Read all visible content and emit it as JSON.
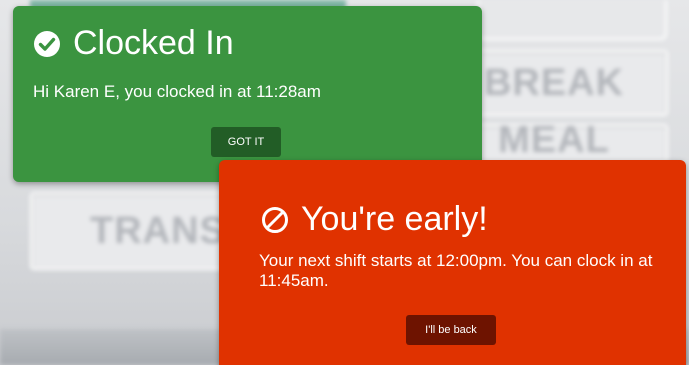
{
  "background": {
    "buttons": [
      {
        "label": "BREAK"
      },
      {
        "label": "MEAL"
      },
      {
        "label": "TRANSFER"
      }
    ]
  },
  "toasts": {
    "clocked_in": {
      "icon": "check-circle-icon",
      "title": "Clocked In",
      "message": "Hi Karen E, you clocked in at 11:28am",
      "button_label": "GOT IT",
      "color": "#3b9440"
    },
    "early": {
      "icon": "prohibited-icon",
      "title": "You're early!",
      "message": "Your next shift starts at 12:00pm. You can clock in at 11:45am.",
      "button_label": "I'll be back",
      "color": "#e03200"
    }
  }
}
